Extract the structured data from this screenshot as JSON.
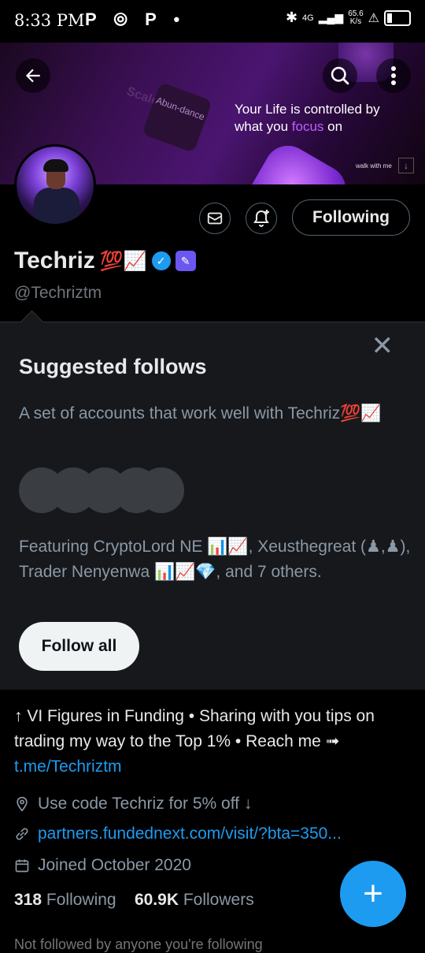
{
  "status_bar": {
    "time": "8:33 PM",
    "left_icons": "P ⦾ P •",
    "speed": "65.6\nK/s",
    "network": "4G"
  },
  "banner": {
    "tagline_part1": "Your Life is controlled by",
    "tagline_part2": "what you",
    "tagline_focus": "focus",
    "tagline_part3": "on",
    "card_text": "Abun-dance",
    "faint_text": "Scale",
    "walk_text": "walk with me"
  },
  "profile": {
    "name": "Techriz",
    "name_emoji": "💯📈",
    "handle": "@Techriztm",
    "following_label": "Following"
  },
  "suggested": {
    "title": "Suggested follows",
    "description": "A set of accounts that work well with Techriz💯📈",
    "featuring": "Featuring CryptoLord NE 📊📈, Xeusthegreat (♟,♟), Trader Nenyenwa 📊📈💎, and 7 others.",
    "follow_all_label": "Follow all"
  },
  "bio": {
    "text": "↑ VI Figures in Funding • Sharing with you tips on trading my way to the Top 1% • Reach me ➟",
    "link": "t.me/Techriztm"
  },
  "meta": {
    "promo": "Use code Techriz for 5% off ↓",
    "website": "partners.fundednext.com/visit/?bta=350...",
    "joined": "Joined October 2020"
  },
  "counts": {
    "following_num": "318",
    "following_label": "Following",
    "followers_num": "60.9K",
    "followers_label": "Followers"
  },
  "cut_text": "Not followed by anyone you're following",
  "colors": {
    "accent": "#1d9bf0",
    "background": "#000000",
    "panel": "#16181c"
  }
}
